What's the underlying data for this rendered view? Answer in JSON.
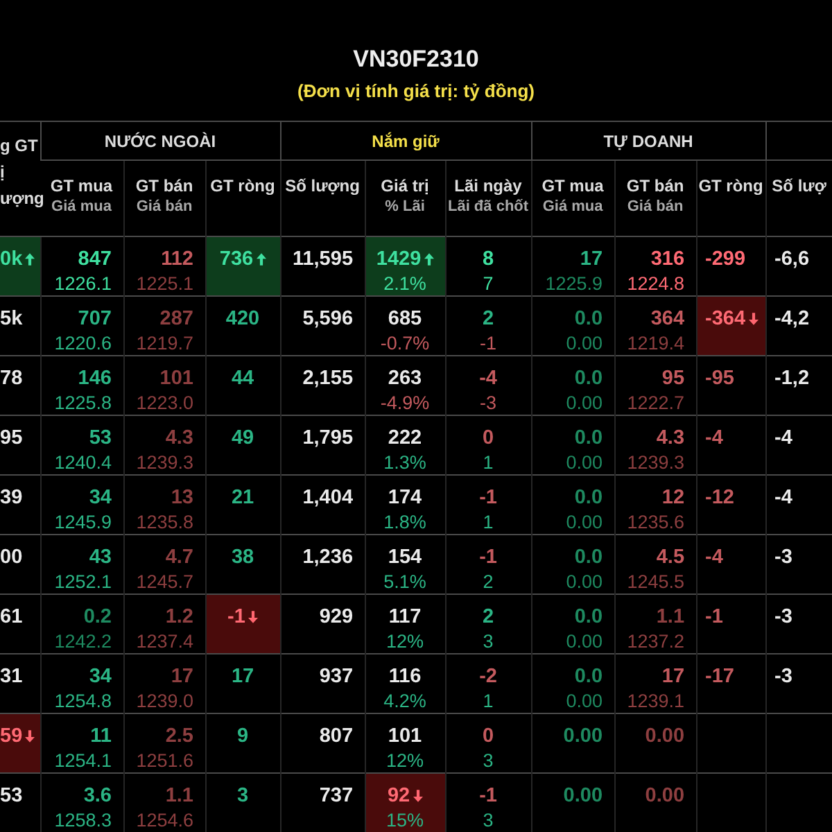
{
  "title": "VN30F2310",
  "subtitle": "(Đơn vị tính giá trị: tỷ đồng)",
  "header": {
    "corner": [
      "g GT",
      "ị",
      "ượng"
    ],
    "groups": [
      {
        "label": "NƯỚC NGOÀI",
        "accent": false
      },
      {
        "label": "Nắm giữ",
        "accent": true
      },
      {
        "label": "TỰ DOANH",
        "accent": false
      }
    ],
    "columns": [
      {
        "label": "GT mua",
        "sub": "Giá mua"
      },
      {
        "label": "GT bán",
        "sub": "Giá bán"
      },
      {
        "label": "GT ròng"
      },
      {
        "label": "Số lượng"
      },
      {
        "label": "Giá trị",
        "sub": "% Lãi"
      },
      {
        "label": "Lãi ngày",
        "sub": "Lãi đã chốt"
      },
      {
        "label": "GT mua",
        "sub": "Giá mua"
      },
      {
        "label": "GT bán",
        "sub": "Giá bán"
      },
      {
        "label": "GT ròng"
      },
      {
        "label": "Số lượ"
      }
    ]
  },
  "rows": [
    {
      "cells": [
        {
          "text": "0k",
          "color": "#3fe0a0",
          "highlighted": true,
          "rising": true
        },
        {
          "text": "847",
          "color": "#3fe0a0",
          "sub": {
            "text": "1226.1",
            "color": "#3fe0a0"
          },
          "highlighted": false
        },
        {
          "text": "112",
          "color": "#c45a5e",
          "sub": {
            "text": "1225.1",
            "color": "#8e3f40"
          },
          "highlighted": false
        },
        {
          "text": "736",
          "color": "#3fe0a0",
          "highlighted": true,
          "rising": true
        },
        {
          "text": "11,595",
          "color": "#eaeaea",
          "highlighted": false
        },
        {
          "text": "1429",
          "color": "#3fe0a0",
          "sub": {
            "text": "2.1%",
            "color": "#3fe0a0"
          },
          "highlighted": true,
          "rising": true
        },
        {
          "text": "8",
          "color": "#3fe0a0",
          "sub": {
            "text": "7",
            "color": "#3fe0a0"
          },
          "highlighted": false
        },
        {
          "text": "17",
          "color": "#2bb585",
          "sub": {
            "text": "1225.9",
            "color": "#1e8a60"
          },
          "highlighted": false
        },
        {
          "text": "316",
          "color": "#ff6a74",
          "sub": {
            "text": "1224.8",
            "color": "#ff6a74"
          },
          "highlighted": false
        },
        {
          "text": "-299",
          "color": "#ff6a74",
          "highlighted": false
        },
        {
          "text": "-6,6",
          "color": "#eaeaea",
          "highlighted": false
        }
      ]
    },
    {
      "cells": [
        {
          "text": "5k",
          "color": "#eaeaea",
          "highlighted": false
        },
        {
          "text": "707",
          "color": "#2bb585",
          "sub": {
            "text": "1220.6",
            "color": "#2bb585"
          },
          "highlighted": false
        },
        {
          "text": "287",
          "color": "#8e3f40",
          "sub": {
            "text": "1219.7",
            "color": "#8e3f40"
          },
          "highlighted": false
        },
        {
          "text": "420",
          "color": "#2bb585",
          "highlighted": false
        },
        {
          "text": "5,596",
          "color": "#eaeaea",
          "highlighted": false
        },
        {
          "text": "685",
          "color": "#eaeaea",
          "sub": {
            "text": "-0.7%",
            "color": "#c45a5e"
          },
          "highlighted": false
        },
        {
          "text": "2",
          "color": "#2bb585",
          "sub": {
            "text": "-1",
            "color": "#c45a5e"
          },
          "highlighted": false
        },
        {
          "text": "0.0",
          "color": "#1e8a60",
          "sub": {
            "text": "0.00",
            "color": "#1e8a60"
          },
          "highlighted": false
        },
        {
          "text": "364",
          "color": "#c45a5e",
          "sub": {
            "text": "1219.4",
            "color": "#8e3f40"
          },
          "highlighted": false
        },
        {
          "text": "-364",
          "color": "#ff6a74",
          "highlighted": true,
          "rising": false
        },
        {
          "text": "-4,2",
          "color": "#eaeaea",
          "highlighted": false
        }
      ]
    },
    {
      "cells": [
        {
          "text": "78",
          "color": "#eaeaea",
          "highlighted": false
        },
        {
          "text": "146",
          "color": "#2bb585",
          "sub": {
            "text": "1225.8",
            "color": "#2bb585"
          },
          "highlighted": false
        },
        {
          "text": "101",
          "color": "#8e3f40",
          "sub": {
            "text": "1223.0",
            "color": "#8e3f40"
          },
          "highlighted": false
        },
        {
          "text": "44",
          "color": "#2bb585",
          "highlighted": false
        },
        {
          "text": "2,155",
          "color": "#eaeaea",
          "highlighted": false
        },
        {
          "text": "263",
          "color": "#eaeaea",
          "sub": {
            "text": "-4.9%",
            "color": "#c45a5e"
          },
          "highlighted": false
        },
        {
          "text": "-4",
          "color": "#c45a5e",
          "sub": {
            "text": "-3",
            "color": "#c45a5e"
          },
          "highlighted": false
        },
        {
          "text": "0.0",
          "color": "#1e8a60",
          "sub": {
            "text": "0.00",
            "color": "#1e8a60"
          },
          "highlighted": false
        },
        {
          "text": "95",
          "color": "#c45a5e",
          "sub": {
            "text": "1222.7",
            "color": "#8e3f40"
          },
          "highlighted": false
        },
        {
          "text": "-95",
          "color": "#c45a5e",
          "highlighted": false
        },
        {
          "text": "-1,2",
          "color": "#eaeaea",
          "highlighted": false
        }
      ]
    },
    {
      "cells": [
        {
          "text": "95",
          "color": "#eaeaea",
          "highlighted": false
        },
        {
          "text": "53",
          "color": "#2bb585",
          "sub": {
            "text": "1240.4",
            "color": "#2bb585"
          },
          "highlighted": false
        },
        {
          "text": "4.3",
          "color": "#8e3f40",
          "sub": {
            "text": "1239.3",
            "color": "#8e3f40"
          },
          "highlighted": false
        },
        {
          "text": "49",
          "color": "#2bb585",
          "highlighted": false
        },
        {
          "text": "1,795",
          "color": "#eaeaea",
          "highlighted": false
        },
        {
          "text": "222",
          "color": "#eaeaea",
          "sub": {
            "text": "1.3%",
            "color": "#2bb585"
          },
          "highlighted": false
        },
        {
          "text": "0",
          "color": "#c45a5e",
          "sub": {
            "text": "1",
            "color": "#2bb585"
          },
          "highlighted": false
        },
        {
          "text": "0.0",
          "color": "#1e8a60",
          "sub": {
            "text": "0.00",
            "color": "#1e8a60"
          },
          "highlighted": false
        },
        {
          "text": "4.3",
          "color": "#c45a5e",
          "sub": {
            "text": "1239.3",
            "color": "#8e3f40"
          },
          "highlighted": false
        },
        {
          "text": "-4",
          "color": "#c45a5e",
          "highlighted": false
        },
        {
          "text": "-4",
          "color": "#eaeaea",
          "highlighted": false
        }
      ]
    },
    {
      "cells": [
        {
          "text": "39",
          "color": "#eaeaea",
          "highlighted": false
        },
        {
          "text": "34",
          "color": "#2bb585",
          "sub": {
            "text": "1245.9",
            "color": "#2bb585"
          },
          "highlighted": false
        },
        {
          "text": "13",
          "color": "#8e3f40",
          "sub": {
            "text": "1235.8",
            "color": "#8e3f40"
          },
          "highlighted": false
        },
        {
          "text": "21",
          "color": "#2bb585",
          "highlighted": false
        },
        {
          "text": "1,404",
          "color": "#eaeaea",
          "highlighted": false
        },
        {
          "text": "174",
          "color": "#eaeaea",
          "sub": {
            "text": "1.8%",
            "color": "#2bb585"
          },
          "highlighted": false
        },
        {
          "text": "-1",
          "color": "#c45a5e",
          "sub": {
            "text": "1",
            "color": "#2bb585"
          },
          "highlighted": false
        },
        {
          "text": "0.0",
          "color": "#1e8a60",
          "sub": {
            "text": "0.00",
            "color": "#1e8a60"
          },
          "highlighted": false
        },
        {
          "text": "12",
          "color": "#c45a5e",
          "sub": {
            "text": "1235.6",
            "color": "#8e3f40"
          },
          "highlighted": false
        },
        {
          "text": "-12",
          "color": "#c45a5e",
          "highlighted": false
        },
        {
          "text": "-4",
          "color": "#eaeaea",
          "highlighted": false
        }
      ]
    },
    {
      "cells": [
        {
          "text": "00",
          "color": "#eaeaea",
          "highlighted": false
        },
        {
          "text": "43",
          "color": "#2bb585",
          "sub": {
            "text": "1252.1",
            "color": "#2bb585"
          },
          "highlighted": false
        },
        {
          "text": "4.7",
          "color": "#8e3f40",
          "sub": {
            "text": "1245.7",
            "color": "#8e3f40"
          },
          "highlighted": false
        },
        {
          "text": "38",
          "color": "#2bb585",
          "highlighted": false
        },
        {
          "text": "1,236",
          "color": "#eaeaea",
          "highlighted": false
        },
        {
          "text": "154",
          "color": "#eaeaea",
          "sub": {
            "text": "5.1%",
            "color": "#2bb585"
          },
          "highlighted": false
        },
        {
          "text": "-1",
          "color": "#c45a5e",
          "sub": {
            "text": "2",
            "color": "#2bb585"
          },
          "highlighted": false
        },
        {
          "text": "0.0",
          "color": "#1e8a60",
          "sub": {
            "text": "0.00",
            "color": "#1e8a60"
          },
          "highlighted": false
        },
        {
          "text": "4.5",
          "color": "#c45a5e",
          "sub": {
            "text": "1245.5",
            "color": "#8e3f40"
          },
          "highlighted": false
        },
        {
          "text": "-4",
          "color": "#c45a5e",
          "highlighted": false
        },
        {
          "text": "-3",
          "color": "#eaeaea",
          "highlighted": false
        }
      ]
    },
    {
      "cells": [
        {
          "text": "61",
          "color": "#eaeaea",
          "highlighted": false
        },
        {
          "text": "0.2",
          "color": "#1e8a60",
          "sub": {
            "text": "1242.2",
            "color": "#1e8a60"
          },
          "highlighted": false
        },
        {
          "text": "1.2",
          "color": "#8e3f40",
          "sub": {
            "text": "1237.4",
            "color": "#8e3f40"
          },
          "highlighted": false
        },
        {
          "text": "-1",
          "color": "#ff6a74",
          "highlighted": true,
          "rising": false
        },
        {
          "text": "929",
          "color": "#eaeaea",
          "highlighted": false
        },
        {
          "text": "117",
          "color": "#eaeaea",
          "sub": {
            "text": "12%",
            "color": "#2bb585"
          },
          "highlighted": false
        },
        {
          "text": "2",
          "color": "#2bb585",
          "sub": {
            "text": "3",
            "color": "#2bb585"
          },
          "highlighted": false
        },
        {
          "text": "0.0",
          "color": "#1e8a60",
          "sub": {
            "text": "0.00",
            "color": "#1e8a60"
          },
          "highlighted": false
        },
        {
          "text": "1.1",
          "color": "#8e3f40",
          "sub": {
            "text": "1237.2",
            "color": "#8e3f40"
          },
          "highlighted": false
        },
        {
          "text": "-1",
          "color": "#c45a5e",
          "highlighted": false
        },
        {
          "text": "-3",
          "color": "#eaeaea",
          "highlighted": false
        }
      ]
    },
    {
      "cells": [
        {
          "text": "31",
          "color": "#eaeaea",
          "highlighted": false
        },
        {
          "text": "34",
          "color": "#2bb585",
          "sub": {
            "text": "1254.8",
            "color": "#2bb585"
          },
          "highlighted": false
        },
        {
          "text": "17",
          "color": "#8e3f40",
          "sub": {
            "text": "1239.0",
            "color": "#8e3f40"
          },
          "highlighted": false
        },
        {
          "text": "17",
          "color": "#2bb585",
          "highlighted": false
        },
        {
          "text": "937",
          "color": "#eaeaea",
          "highlighted": false
        },
        {
          "text": "116",
          "color": "#eaeaea",
          "sub": {
            "text": "4.2%",
            "color": "#2bb585"
          },
          "highlighted": false
        },
        {
          "text": "-2",
          "color": "#c45a5e",
          "sub": {
            "text": "1",
            "color": "#2bb585"
          },
          "highlighted": false
        },
        {
          "text": "0.0",
          "color": "#1e8a60",
          "sub": {
            "text": "0.00",
            "color": "#1e8a60"
          },
          "highlighted": false
        },
        {
          "text": "17",
          "color": "#c45a5e",
          "sub": {
            "text": "1239.1",
            "color": "#8e3f40"
          },
          "highlighted": false
        },
        {
          "text": "-17",
          "color": "#c45a5e",
          "highlighted": false
        },
        {
          "text": "-3",
          "color": "#eaeaea",
          "highlighted": false
        }
      ]
    },
    {
      "cells": [
        {
          "text": "59",
          "color": "#ff6a74",
          "highlighted": true,
          "rising": false
        },
        {
          "text": "11",
          "color": "#2bb585",
          "sub": {
            "text": "1254.1",
            "color": "#2bb585"
          },
          "highlighted": false
        },
        {
          "text": "2.5",
          "color": "#8e3f40",
          "sub": {
            "text": "1251.6",
            "color": "#8e3f40"
          },
          "highlighted": false
        },
        {
          "text": "9",
          "color": "#2bb585",
          "highlighted": false
        },
        {
          "text": "807",
          "color": "#eaeaea",
          "highlighted": false
        },
        {
          "text": "101",
          "color": "#eaeaea",
          "sub": {
            "text": "12%",
            "color": "#2bb585"
          },
          "highlighted": false
        },
        {
          "text": "0",
          "color": "#c45a5e",
          "sub": {
            "text": "3",
            "color": "#2bb585"
          },
          "highlighted": false
        },
        {
          "text": "0.00",
          "color": "#1e8a60",
          "highlighted": false
        },
        {
          "text": "0.00",
          "color": "#8e3f40",
          "highlighted": false
        },
        {
          "highlighted": false
        },
        {
          "highlighted": false
        }
      ]
    },
    {
      "cells": [
        {
          "text": "53",
          "color": "#eaeaea",
          "highlighted": false
        },
        {
          "text": "3.6",
          "color": "#2bb585",
          "sub": {
            "text": "1258.3",
            "color": "#2bb585"
          },
          "highlighted": false
        },
        {
          "text": "1.1",
          "color": "#8e3f40",
          "sub": {
            "text": "1254.6",
            "color": "#8e3f40"
          },
          "highlighted": false
        },
        {
          "text": "3",
          "color": "#2bb585",
          "highlighted": false
        },
        {
          "text": "737",
          "color": "#eaeaea",
          "highlighted": false
        },
        {
          "text": "92",
          "color": "#ff6a74",
          "sub": {
            "text": "15%",
            "color": "#2bb585"
          },
          "highlighted": true,
          "rising": false
        },
        {
          "text": "-1",
          "color": "#c45a5e",
          "sub": {
            "text": "3",
            "color": "#2bb585"
          },
          "highlighted": false
        },
        {
          "text": "0.00",
          "color": "#1e8a60",
          "highlighted": false
        },
        {
          "text": "0.00",
          "color": "#8e3f40",
          "highlighted": false
        },
        {
          "highlighted": false
        },
        {
          "highlighted": false
        }
      ]
    }
  ]
}
